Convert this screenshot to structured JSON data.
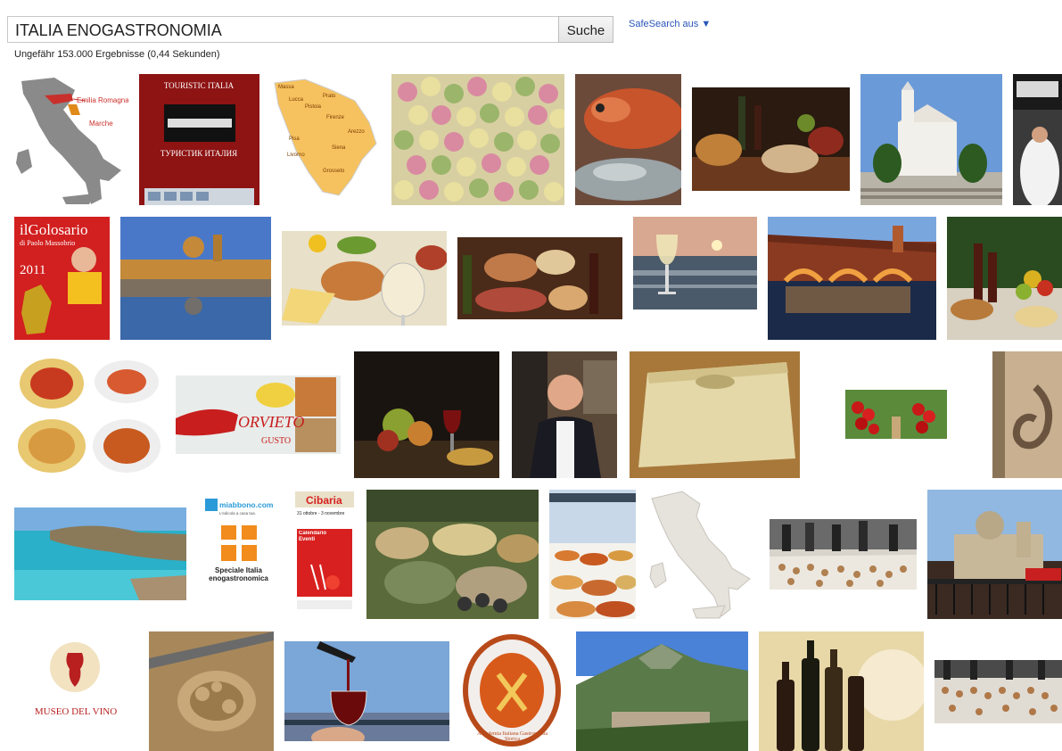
{
  "search": {
    "query": "ITALIA ENOGASTRONOMIA",
    "button_label": "Suche"
  },
  "safesearch": {
    "label": "SafeSearch aus",
    "arrow": "▼"
  },
  "results": {
    "stats": "Ungefähr 153.000 Ergebnisse (0,44 Sekunden)"
  },
  "thumb_text": {
    "map_emilia": "Emilia Romagna",
    "map_marche": "Marche",
    "touristic_title": "TOURISTIC ITALIA",
    "touristic_cyrillic": "ТУРИСТИК ИТАЛИЯ",
    "tuscany_cities": [
      "Massa",
      "Lucca",
      "Prato",
      "Pistoia",
      "Firenze",
      "Arezzo",
      "Pisa",
      "Livorno",
      "Siena",
      "Grosseto"
    ],
    "golosario_title": "ilGolosario",
    "golosario_author": "di Paolo Massobrio",
    "golosario_year": "2011",
    "orvieto": "ORVIETO",
    "orvieto_gusto": "GUSTO",
    "miabbono": "miabbono.com",
    "miabbono_sub": "L'edicola a casa tua.",
    "miabbono_speciale": "Speciale Italia enogastronomica",
    "cibaria": "Cibaria",
    "cibaria_dates": "31 ottobre - 3 novembre",
    "cibaria_calendario": "Calendario Eventi",
    "museo": "MUSEO DEL VINO",
    "accademia": "Accademia Italiana Gastronomia Storica"
  }
}
